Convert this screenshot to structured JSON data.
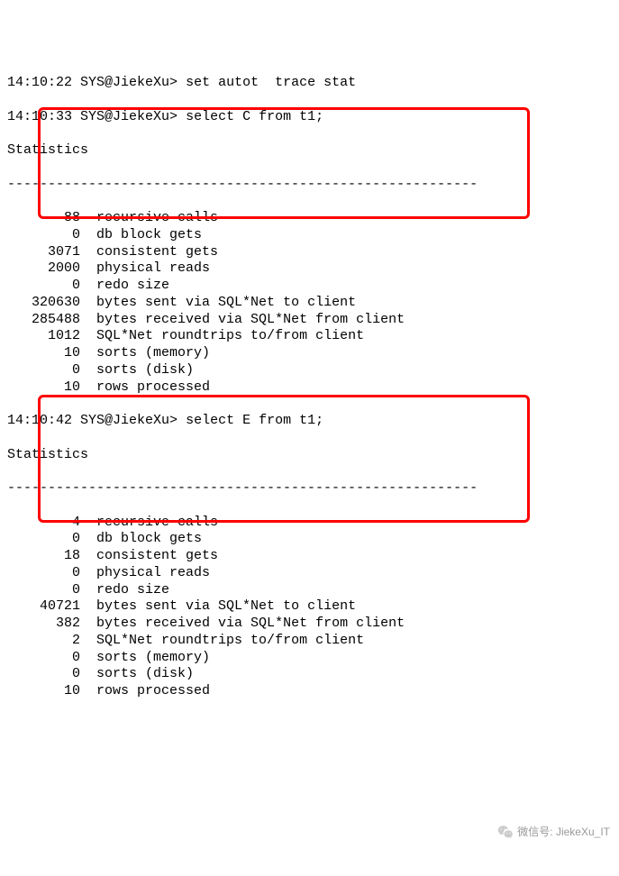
{
  "block1": {
    "prompt1_time": "14:10:22",
    "prompt1_user": "SYS@JiekeXu>",
    "prompt1_cmd": "set autot  trace stat",
    "prompt2_time": "14:10:33",
    "prompt2_user": "SYS@JiekeXu>",
    "prompt2_cmd": "select C from t1;",
    "stats_header": "Statistics",
    "dashes": "----------------------------------------------------------",
    "rows": [
      {
        "val": "88",
        "label": "recursive calls"
      },
      {
        "val": "0",
        "label": "db block gets"
      },
      {
        "val": "3071",
        "label": "consistent gets"
      },
      {
        "val": "2000",
        "label": "physical reads"
      },
      {
        "val": "0",
        "label": "redo size"
      },
      {
        "val": "320630",
        "label": "bytes sent via SQL*Net to client"
      },
      {
        "val": "285488",
        "label": "bytes received via SQL*Net from client"
      },
      {
        "val": "1012",
        "label": "SQL*Net roundtrips to/from client"
      },
      {
        "val": "10",
        "label": "sorts (memory)"
      },
      {
        "val": "0",
        "label": "sorts (disk)"
      },
      {
        "val": "10",
        "label": "rows processed"
      }
    ]
  },
  "block2": {
    "prompt_time": "14:10:42",
    "prompt_user": "SYS@JiekeXu>",
    "prompt_cmd": "select E from t1;",
    "stats_header": "Statistics",
    "dashes": "----------------------------------------------------------",
    "rows": [
      {
        "val": "4",
        "label": "recursive calls"
      },
      {
        "val": "0",
        "label": "db block gets"
      },
      {
        "val": "18",
        "label": "consistent gets"
      },
      {
        "val": "0",
        "label": "physical reads"
      },
      {
        "val": "0",
        "label": "redo size"
      },
      {
        "val": "40721",
        "label": "bytes sent via SQL*Net to client"
      },
      {
        "val": "382",
        "label": "bytes received via SQL*Net from client"
      },
      {
        "val": "2",
        "label": "SQL*Net roundtrips to/from client"
      },
      {
        "val": "0",
        "label": "sorts (memory)"
      },
      {
        "val": "0",
        "label": "sorts (disk)"
      },
      {
        "val": "10",
        "label": "rows processed"
      }
    ]
  },
  "watermark": {
    "label": "微信号",
    "value": "JiekeXu_IT"
  }
}
